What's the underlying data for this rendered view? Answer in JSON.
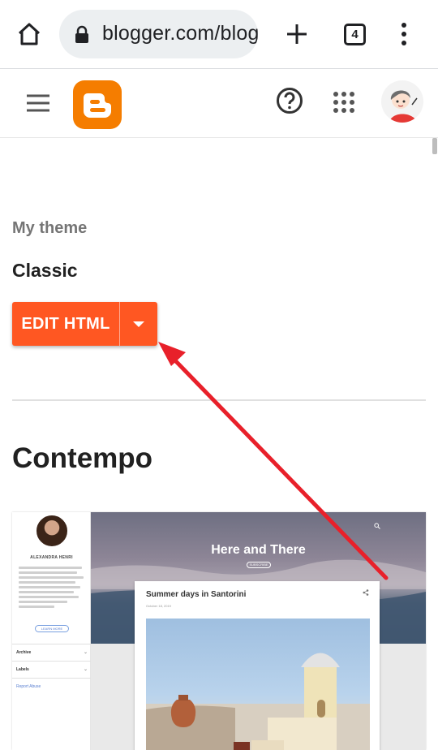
{
  "browser": {
    "url": "blogger.com/blog",
    "tab_count": "4",
    "icons": [
      "home-icon",
      "lock-icon",
      "new-tab-icon",
      "tab-switcher-icon",
      "more-vert-icon"
    ]
  },
  "appbar": {
    "icons": [
      "menu-icon",
      "blogger-logo",
      "help-icon",
      "apps-grid-icon",
      "account-avatar"
    ],
    "brand_color": "#f57d00"
  },
  "current_theme": {
    "label": "My theme",
    "name": "Classic",
    "edit_button_label": "EDIT HTML",
    "accent_color": "#ff5722"
  },
  "theme_gallery": {
    "title": "Contempo",
    "preview": {
      "author_name": "ALEXANDRA HENRI",
      "learn_more": "LEARN MORE",
      "sidebar_items": [
        "Archive",
        "Labels"
      ],
      "report_abuse": "Report Abuse",
      "blog_title": "Here and There",
      "subscribe": "SUBSCRIBE",
      "post_title": "Summer days in Santorini",
      "post_date": "October 18, 2019"
    }
  },
  "annotation": {
    "type": "arrow",
    "color": "#e8202a",
    "points_to": "edit-html-dropdown"
  }
}
